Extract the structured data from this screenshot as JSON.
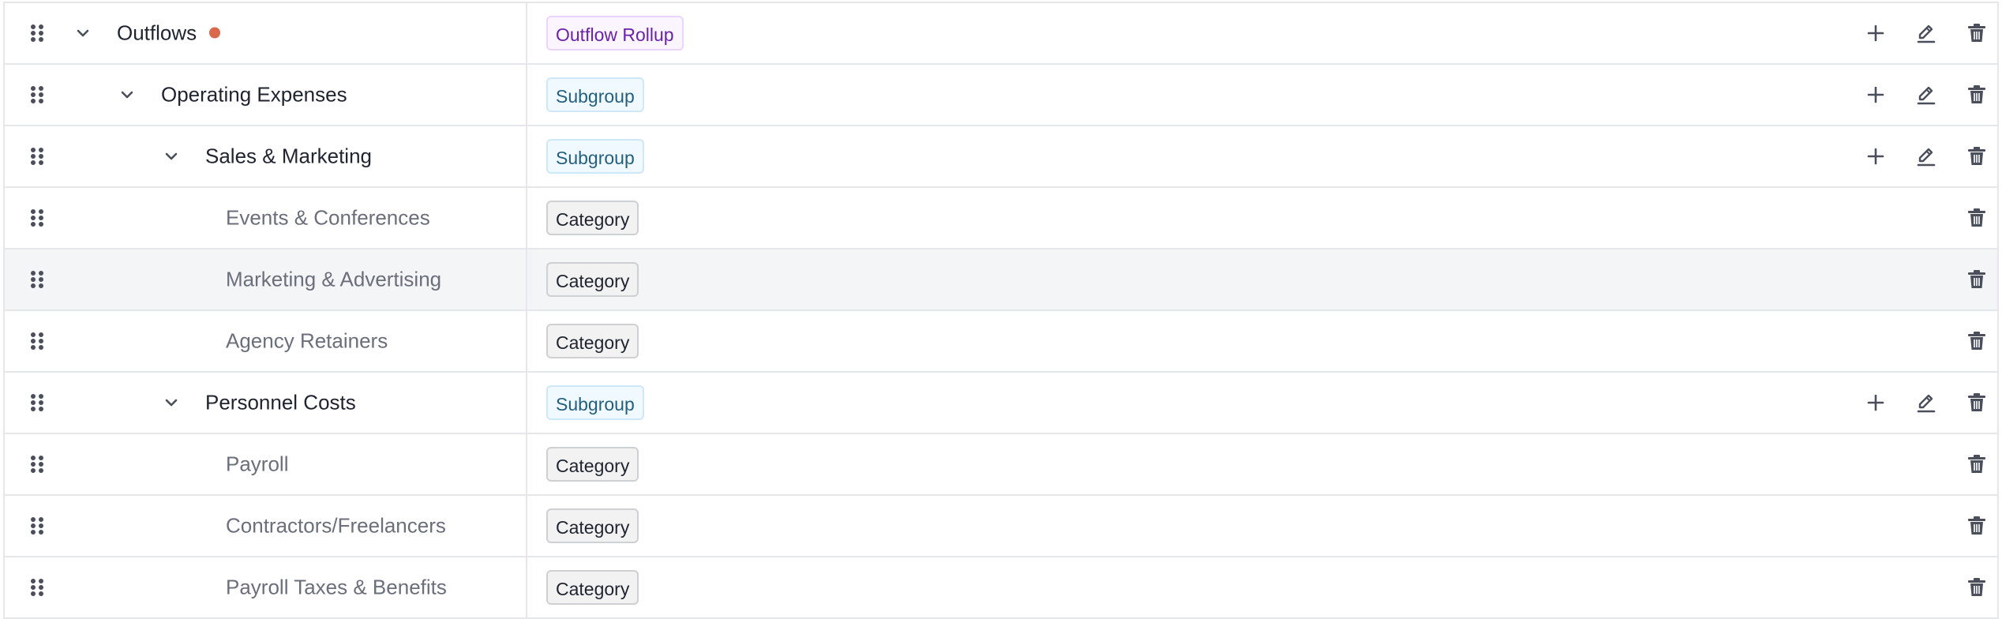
{
  "colors": {
    "row_border": "#e5e7eb",
    "status_dot": "#d9694a",
    "rollup_badge_text": "#6b21a8",
    "subgroup_badge_text": "#245f7e",
    "category_badge_text": "#1f2430",
    "icon": "#4b4f5c"
  },
  "rows": [
    {
      "label": "Outflows",
      "badge": "Outflow Rollup",
      "kind": "rollup",
      "level": 0,
      "expandable": true,
      "has_status_dot": true,
      "actions": [
        "add",
        "edit",
        "delete"
      ]
    },
    {
      "label": "Operating Expenses",
      "badge": "Subgroup",
      "kind": "subgroup",
      "level": 1,
      "expandable": true,
      "actions": [
        "add",
        "edit",
        "delete"
      ]
    },
    {
      "label": "Sales & Marketing",
      "badge": "Subgroup",
      "kind": "subgroup",
      "level": 2,
      "expandable": true,
      "actions": [
        "add",
        "edit",
        "delete"
      ]
    },
    {
      "label": "Events & Conferences",
      "badge": "Category",
      "kind": "category",
      "level": 3,
      "expandable": false,
      "actions": [
        "delete"
      ]
    },
    {
      "label": "Marketing & Advertising",
      "badge": "Category",
      "kind": "category",
      "level": 3,
      "expandable": false,
      "hovered": true,
      "actions": [
        "delete"
      ]
    },
    {
      "label": "Agency Retainers",
      "badge": "Category",
      "kind": "category",
      "level": 3,
      "expandable": false,
      "actions": [
        "delete"
      ]
    },
    {
      "label": "Personnel Costs",
      "badge": "Subgroup",
      "kind": "subgroup",
      "level": 2,
      "expandable": true,
      "actions": [
        "add",
        "edit",
        "delete"
      ]
    },
    {
      "label": "Payroll",
      "badge": "Category",
      "kind": "category",
      "level": 3,
      "expandable": false,
      "actions": [
        "delete"
      ]
    },
    {
      "label": "Contractors/Freelancers",
      "badge": "Category",
      "kind": "category",
      "level": 3,
      "expandable": false,
      "actions": [
        "delete"
      ]
    },
    {
      "label": "Payroll Taxes & Benefits",
      "badge": "Category",
      "kind": "category",
      "level": 3,
      "expandable": false,
      "actions": [
        "delete"
      ]
    }
  ],
  "icons": {
    "drag": "drag-handle-icon",
    "expand": "chevron-down-icon",
    "add": "plus-icon",
    "edit": "pencil-icon",
    "delete": "trash-icon"
  }
}
